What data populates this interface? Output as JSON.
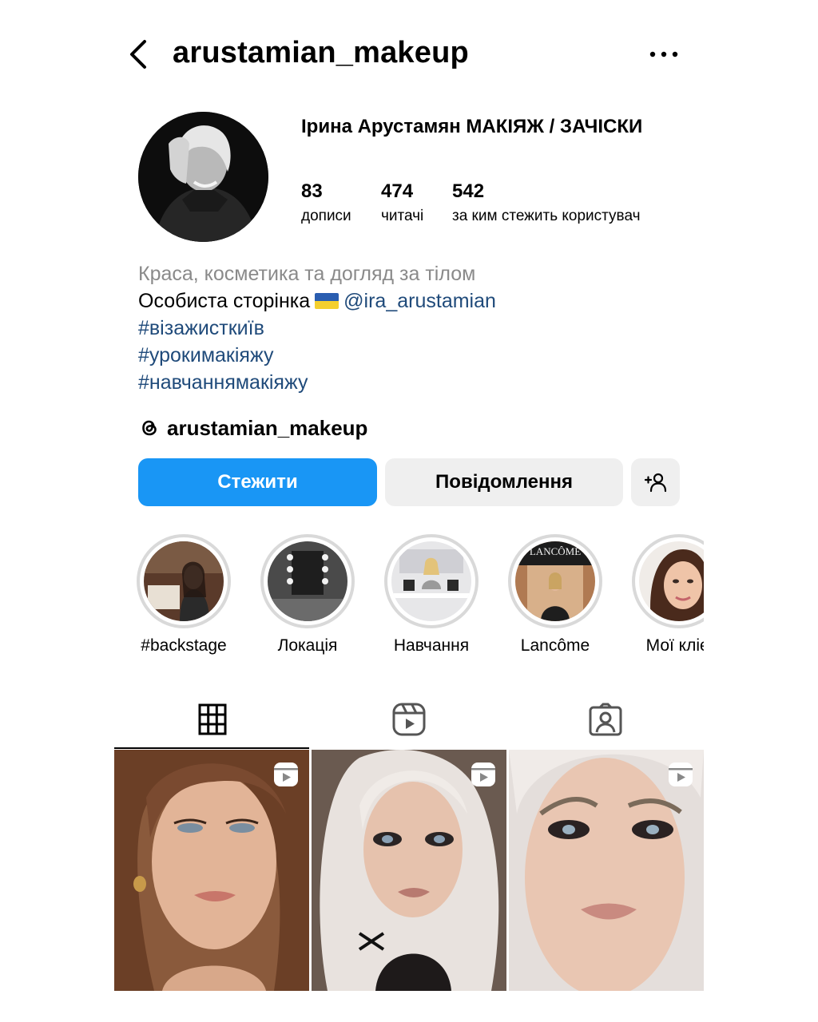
{
  "header": {
    "username": "arustamian_makeup",
    "back_icon": "chevron-left-icon",
    "more_icon": "more-horizontal-icon"
  },
  "profile": {
    "full_name": "Ірина Арустамян  МАКІЯЖ / ЗАЧІСКИ",
    "stats": [
      {
        "count": "83",
        "label": "дописи"
      },
      {
        "count": "474",
        "label": "читачі"
      },
      {
        "count": "542",
        "label": "за ким стежить користувач"
      }
    ]
  },
  "bio": {
    "category": "Краса, косметика та догляд за тілом",
    "line1": "Особиста сторінка",
    "mention": "@ira_arustamian",
    "hashtags": [
      "#візажисткиїв",
      "#урокимакіяжу",
      "#навчаннямакіяжу"
    ],
    "threads_handle": "arustamian_makeup"
  },
  "buttons": {
    "follow": "Стежити",
    "message": "Повідомлення",
    "add_icon": "add-person-icon"
  },
  "highlights": [
    {
      "label": "#backstage"
    },
    {
      "label": "Локація"
    },
    {
      "label": "Навчання"
    },
    {
      "label": "Lancôme"
    },
    {
      "label": "Мої клієі"
    }
  ],
  "highlight_lancome_text": "LANCÔME",
  "tabs": [
    {
      "icon": "grid-icon",
      "active": true
    },
    {
      "icon": "reels-icon",
      "active": false
    },
    {
      "icon": "tagged-icon",
      "active": false
    }
  ],
  "colors": {
    "accent": "#1996f5",
    "link": "#1f4a7a",
    "secondary_text": "#8a8a8a",
    "button_gray": "#efefef"
  }
}
